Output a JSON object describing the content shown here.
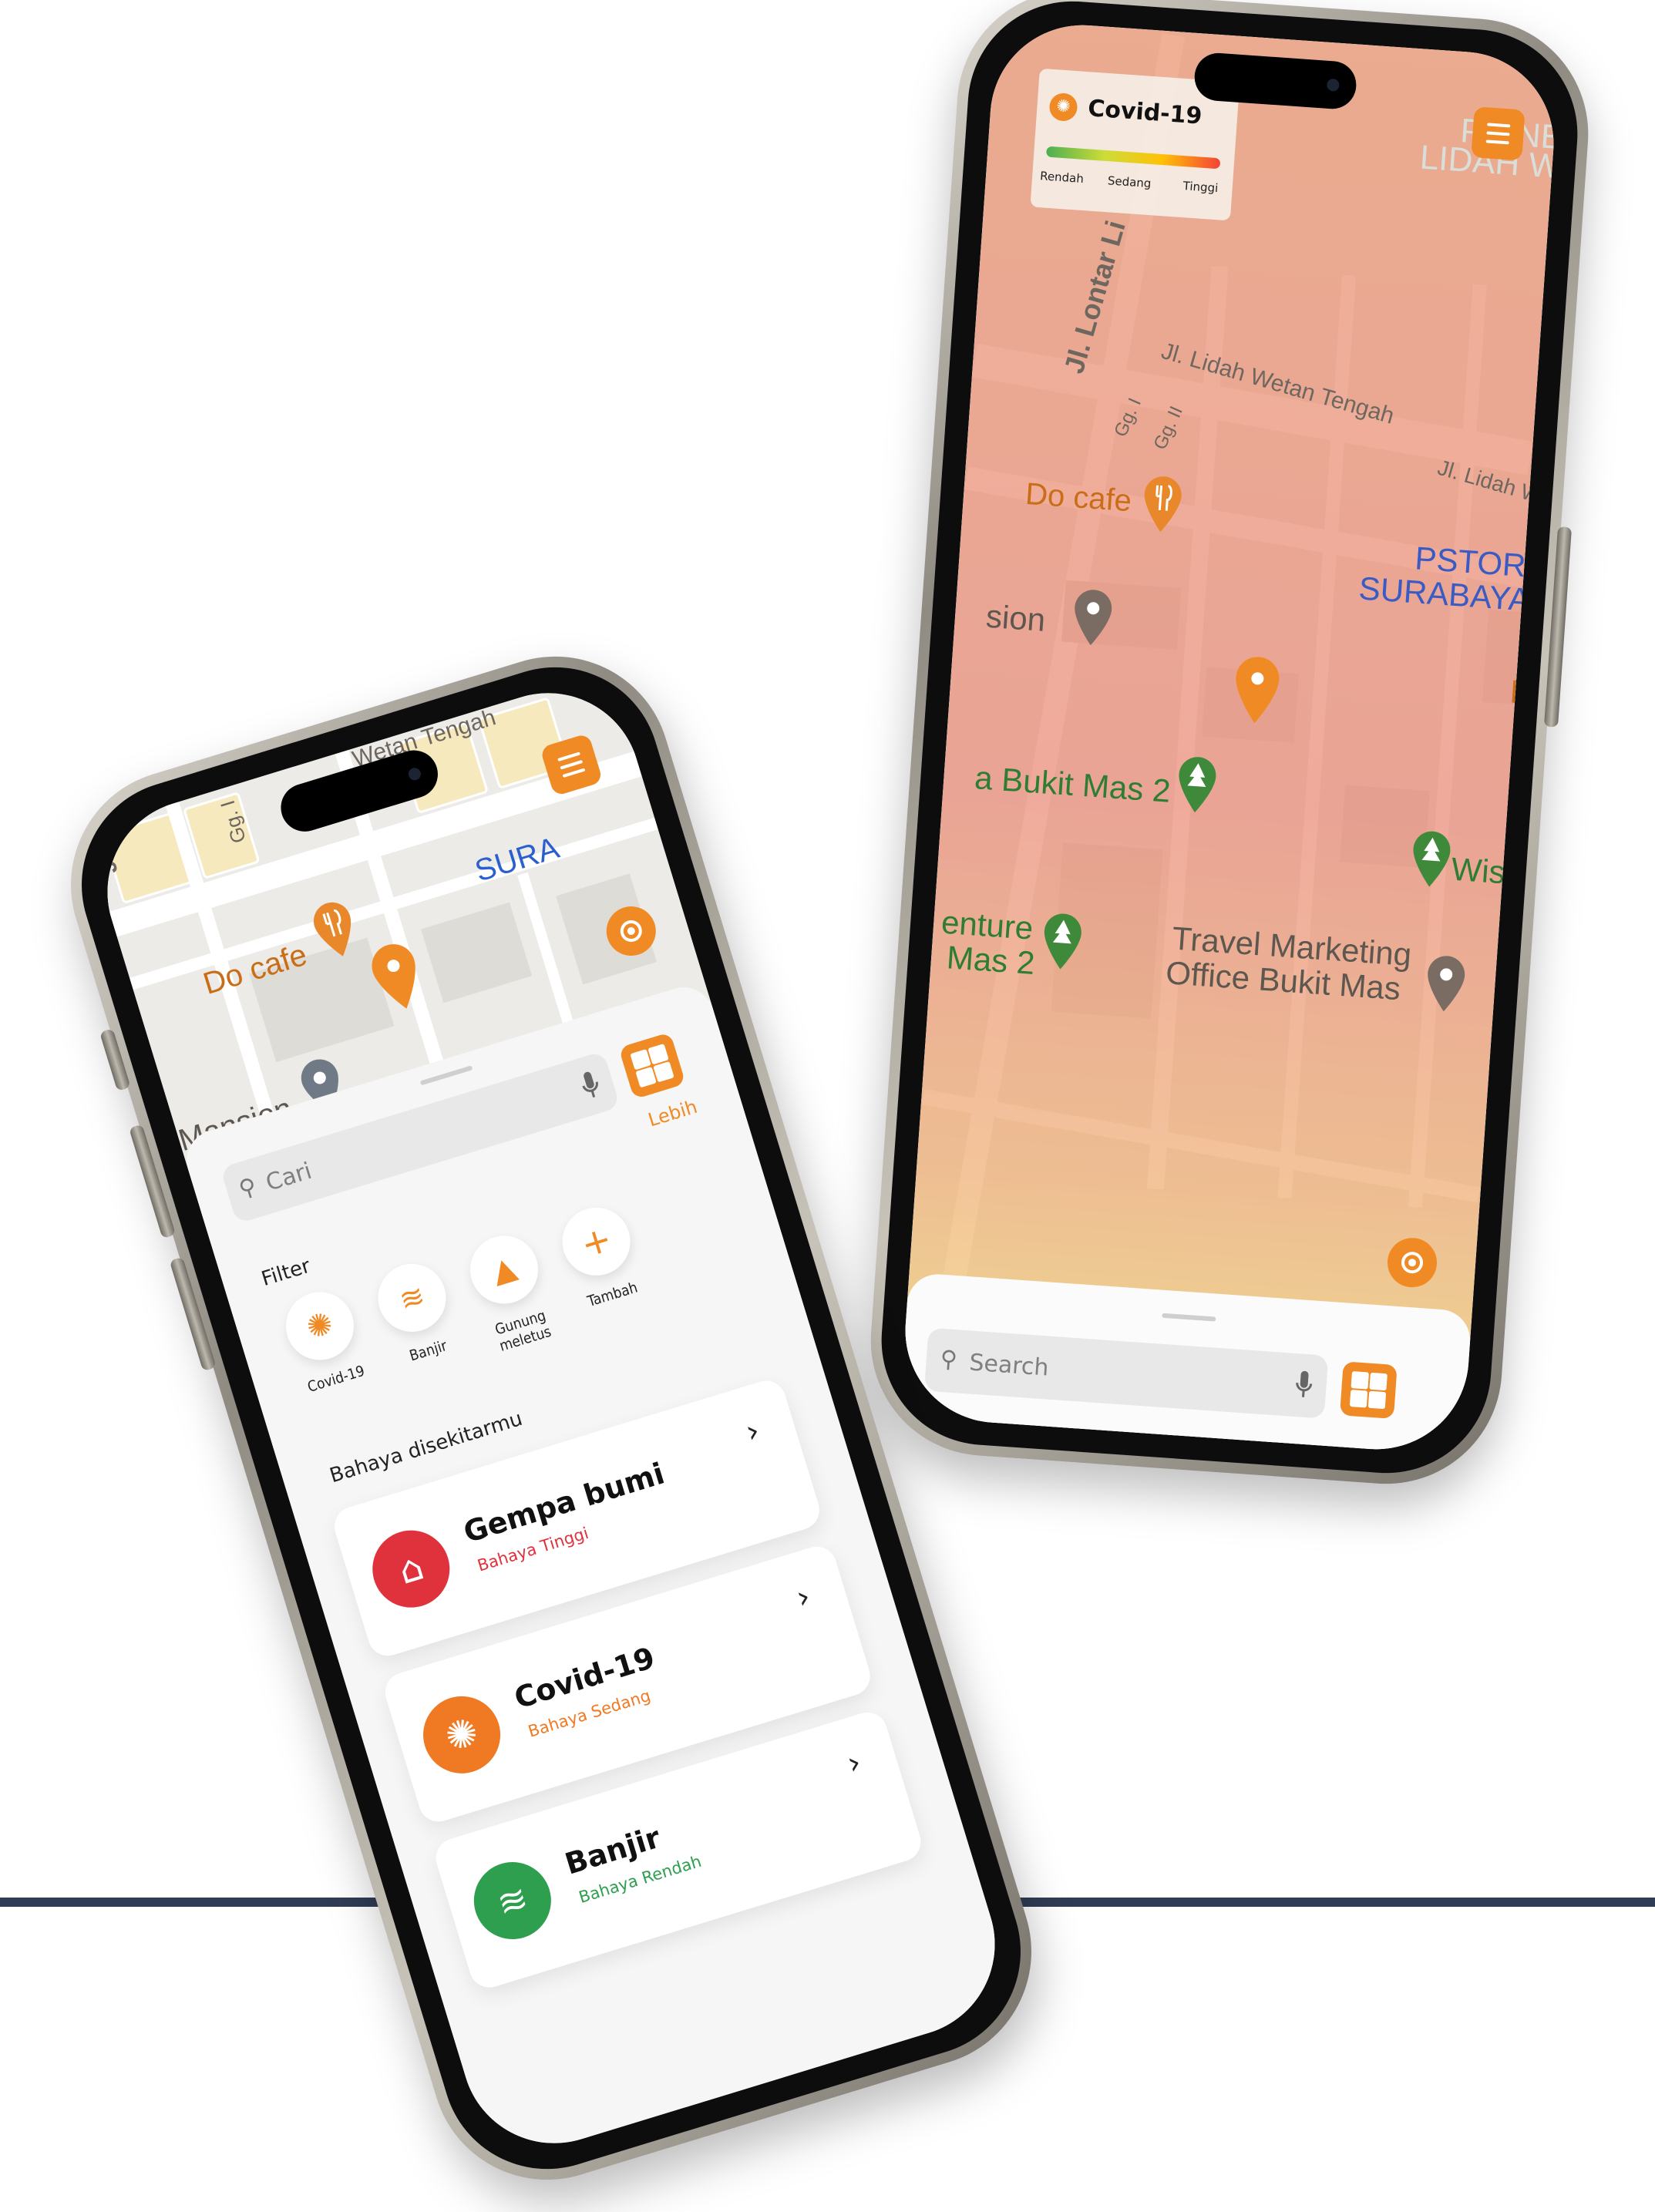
{
  "colors": {
    "accent": "#f08a24",
    "danger_high": "#e0323c",
    "danger_medium": "#f07a24",
    "danger_low": "#2e9e4f",
    "baseline": "#2f3c55"
  },
  "left_phone": {
    "map": {
      "streets": [
        "Jl.",
        "Gg. I",
        "Wetan Tengah"
      ],
      "places": {
        "cafe": "Do cafe",
        "store": "SURA",
        "mansion": "Mansion"
      },
      "menu_icon": "hamburger-menu-icon",
      "locate_icon": "locate-icon"
    },
    "search": {
      "placeholder": "Cari",
      "more_label": "Lebih",
      "mic_icon": "mic-icon",
      "grid_icon": "grid-icon"
    },
    "filter": {
      "title": "Filter",
      "items": [
        {
          "label": "Covid-19",
          "icon": "virus-icon"
        },
        {
          "label": "Banjir",
          "icon": "flood-icon"
        },
        {
          "label": "Gunung meletus",
          "icon": "volcano-icon"
        },
        {
          "label": "Tambah",
          "icon": "plus-icon"
        }
      ]
    },
    "nearby": {
      "title": "Bahaya disekitarmu",
      "items": [
        {
          "title": "Gempa bumi",
          "level": "Bahaya Tinggi",
          "icon": "earthquake-icon"
        },
        {
          "title": "Covid-19",
          "level": "Bahaya Sedang",
          "icon": "virus-icon"
        },
        {
          "title": "Banjir",
          "level": "Bahaya Rendah",
          "icon": "flood-icon"
        }
      ]
    }
  },
  "right_phone": {
    "legend": {
      "title": "Covid-19",
      "low": "Rendah",
      "medium": "Sedang",
      "high": "Tinggi",
      "icon": "virus-icon"
    },
    "map": {
      "places": {
        "unesa_1": "P UNESA",
        "unesa_2": "LIDAH WETA",
        "street_lontar": "Jl. Lontar Li",
        "street_wetan": "Jl. Lidah Wetan Tengah",
        "street_lidah_we": "Jl. Lidah We",
        "gg1": "Gg. I",
        "gg2": "Gg. II",
        "cafe": "Do cafe",
        "pstore_1": "PSTORE",
        "pstore_2": "SURABAYA BIG",
        "mansion": "sion",
        "kyo": "Kyō",
        "bukit": "a Bukit Mas 2",
        "wisata": "Wisat",
        "venture_1": "enture",
        "venture_2": "Mas 2",
        "travel_1": "Travel Marketing",
        "travel_2": "Office Bukit Mas"
      },
      "menu_icon": "hamburger-menu-icon",
      "locate_icon": "locate-icon"
    },
    "search": {
      "placeholder": "Search",
      "mic_icon": "mic-icon",
      "grid_icon": "grid-icon"
    }
  }
}
